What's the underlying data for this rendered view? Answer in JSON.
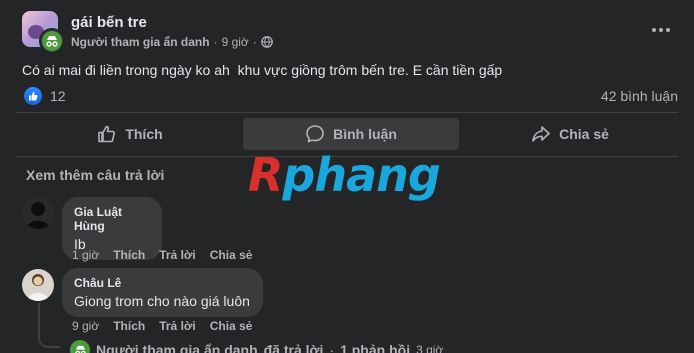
{
  "post": {
    "group_name": "gái bến tre",
    "author": "Người tham gia ẩn danh",
    "separator": "·",
    "time": "9 giờ",
    "privacy_icon": "globe-icon",
    "body": "Có ai mai đi liền trong ngày ko ah  khu vực giồng trôm bến tre. E cần tiền gấp",
    "like_count": "12",
    "comment_count": "42 bình luận"
  },
  "actions": {
    "like": "Thích",
    "comment": "Bình luận",
    "share": "Chia sẻ"
  },
  "comments_section": {
    "see_more": "Xem thêm câu trả lời",
    "comments": [
      {
        "name": "Gia Luật Hùng",
        "text": "Ib",
        "time": "1 giờ",
        "like": "Thích",
        "reply": "Trả lời",
        "share": "Chia sẻ"
      },
      {
        "name": "Châu Lê",
        "text": "Giong trom cho nào giá luôn",
        "time": "9 giờ",
        "like": "Thích",
        "reply": "Trả lời",
        "share": "Chia sẻ"
      }
    ],
    "reply_summary": {
      "actor": "Người tham gia ẩn danh",
      "verb": "đã trả lời",
      "separator": "·",
      "count": "1 phản hồi",
      "time": "3 giờ"
    }
  },
  "watermark": {
    "first": "R",
    "rest": "phang"
  },
  "colors": {
    "background": "#242526",
    "bubble": "#3a3b3c",
    "like_blue": "#2d88ff",
    "anon_green": "#4a9d3a",
    "watermark_red": "#d8312b",
    "watermark_blue": "#1aa7de"
  }
}
